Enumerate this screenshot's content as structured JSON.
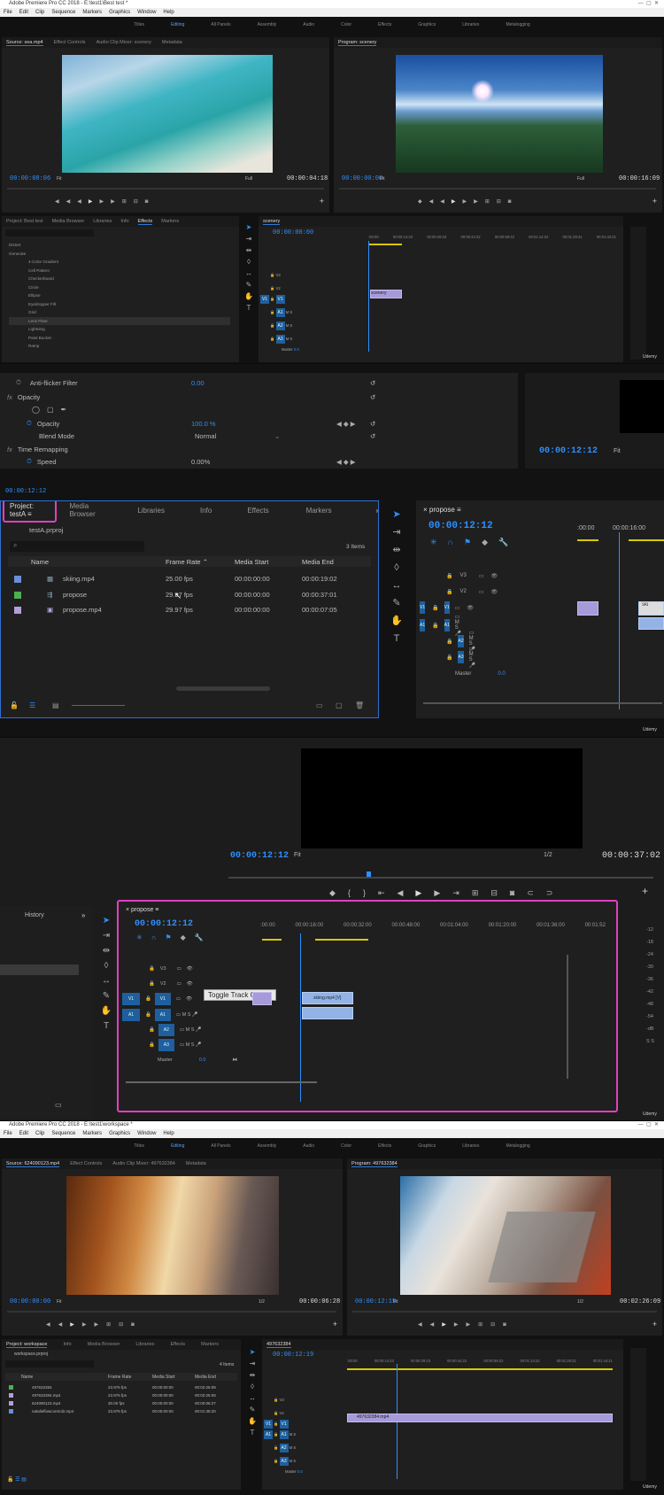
{
  "s1": {
    "title": "Adobe Premiere Pro CC 2018 - E:\\test1\\Best test *",
    "menu": [
      "File",
      "Edit",
      "Clip",
      "Sequence",
      "Markers",
      "Graphics",
      "Window",
      "Help"
    ],
    "workspaces": [
      "Titles",
      "Editing",
      "All Panels",
      "Assembly",
      "Audio",
      "Color",
      "Effects",
      "Graphics",
      "Libraries",
      "Metalogging"
    ],
    "source_tabs": [
      "Source: sea.mp4",
      "Effect Controls",
      "Audio Clip Mixer: scenery",
      "Metadata"
    ],
    "program_tab": "Program: scenery",
    "src_tc": "00:00:08:06",
    "src_fit": "Fit",
    "src_full": "Full",
    "src_dur": "00:00:04:18",
    "prg_tc": "00:00:00:00",
    "prg_fit": "Fit",
    "prg_full": "Full",
    "prg_dur": "00:00:16:09",
    "effects_tabs": [
      "Project: Best test",
      "Media Browser",
      "Libraries",
      "Info",
      "Effects",
      "Markers"
    ],
    "effects_list": [
      "Distort",
      "Generate",
      "4-Color Gradient",
      "Cell Pattern",
      "Checkerboard",
      "Circle",
      "Ellipse",
      "Eyedropper Fill",
      "Grid",
      "Lens Flare",
      "Lightning",
      "Paint Bucket",
      "Ramp"
    ],
    "seq_tab": "scenery",
    "seq_tc": "00:00:00:00",
    "ruler": [
      ":00:00",
      "00:00:14:23",
      "00:00:29:23",
      "00:00:44:22",
      "00:00:59:22",
      "00:01:14:22",
      "00:01:29:21",
      "00:01:44:21"
    ],
    "clip": "scenery",
    "tracks_v": [
      "V3",
      "V2",
      "V1"
    ],
    "tracks_a": [
      "A1",
      "A2",
      "A3"
    ],
    "master": "Master",
    "master_val": "0.0"
  },
  "s2": {
    "ec_rows": [
      "Anti-flicker Filter",
      "Opacity",
      "Opacity",
      "Blend Mode",
      "Time Remapping",
      "Speed"
    ],
    "anti_val": "0.00",
    "opacity_val": "100.0 %",
    "blend_val": "Normal",
    "speed_val": "0.00%",
    "ec_tc": "00:00:12:12",
    "mon_tc": "00:00:12:12",
    "mon_fit": "Fit",
    "proj_tabs": [
      "Project: testA",
      "Media Browser",
      "Libraries",
      "Info",
      "Effects",
      "Markers"
    ],
    "proj_file": "testA.prproj",
    "items_count": "3 Items",
    "cols": [
      "Name",
      "Frame Rate",
      "Media Start",
      "Media End"
    ],
    "rows": [
      {
        "name": "skiing.mp4",
        "fps": "25.00 fps",
        "start": "00:00:00:00",
        "end": "00:00:19:02",
        "color": "#6a8fd8"
      },
      {
        "name": "propose",
        "fps": "29.97 fps",
        "start": "00:00:00:00",
        "end": "00:00:37:01",
        "color": "#4caf50"
      },
      {
        "name": "propose.mp4",
        "fps": "29.97 fps",
        "start": "00:00:00:00",
        "end": "00:00:07:05",
        "color": "#b39ddb"
      }
    ],
    "seq_tab": "propose",
    "seq_tc": "00:00:12:12",
    "ruler": [
      ":00:00",
      "00:00:16:00"
    ],
    "tracks_v": [
      "V3",
      "V2",
      "V1"
    ],
    "tracks_a": [
      "A1",
      "A2",
      "A3"
    ],
    "master": "Master",
    "master_val": "0.0",
    "clip_label": "ski"
  },
  "s3": {
    "prg_tc": "00:00:12:12",
    "prg_fit": "Fit",
    "prg_res": "1/2",
    "prg_dur": "00:00:37:02",
    "history": "History",
    "seq_tab": "propose",
    "seq_tc": "00:00:12:12",
    "ruler": [
      ":00:00",
      "00:00:16:00",
      "00:00:32:00",
      "00:00:48:00",
      "00:01:04:00",
      "00:01:20:00",
      "00:01:36:00",
      "00:01:52"
    ],
    "tracks_v": [
      "V3",
      "V2",
      "V1"
    ],
    "tracks_a": [
      "A1",
      "A2",
      "A3"
    ],
    "tooltip": "Toggle Track Output",
    "clip": "skiing.mp4 [V]",
    "master": "Master",
    "master_val": "0.0",
    "meter": [
      "-12",
      "-18",
      "-24",
      "-30",
      "-36",
      "-42",
      "-48",
      "-54",
      "-dB"
    ],
    "meter_end": "S S"
  },
  "s4": {
    "title": "Adobe Premiere Pro CC 2018 - E:\\test1\\workspace *",
    "menu": [
      "File",
      "Edit",
      "Clip",
      "Sequence",
      "Markers",
      "Graphics",
      "Window",
      "Help"
    ],
    "workspaces": [
      "Titles",
      "Editing",
      "All Panels",
      "Assembly",
      "Audio",
      "Color",
      "Effects",
      "Graphics",
      "Libraries",
      "Metalogging"
    ],
    "source_tabs": [
      "Source: 624090123.mp4",
      "Effect Controls",
      "Audio Clip Mixer: 497632384",
      "Metadata"
    ],
    "program_tab": "Program: 497632384",
    "src_tc": "00:00:00:00",
    "src_fit": "Fit",
    "src_res": "1/2",
    "src_dur": "00:00:06:28",
    "prg_tc": "00:00:12:19",
    "prg_fit": "Fit",
    "prg_res": "1/2",
    "prg_dur": "00:02:26:09",
    "proj_tabs": [
      "Project: workspace",
      "Info",
      "Media Browser",
      "Libraries",
      "Effects",
      "Markers"
    ],
    "proj_file": "workspace.prproj",
    "items_count": "4 Items",
    "cols": [
      "Name",
      "Frame Rate",
      "Media Start",
      "Media End"
    ],
    "rows": [
      {
        "name": "497632384",
        "fps": "23.976 fps",
        "start": "00:00:00:00",
        "end": "00:02:26:08",
        "color": "#4caf50"
      },
      {
        "name": "497632384.mp4",
        "fps": "23.976 fps",
        "start": "00:00:00:00",
        "end": "00:02:26:08",
        "color": "#b39ddb"
      },
      {
        "name": "624090123.mp4",
        "fps": "30.00 fps",
        "start": "00:00:00:00",
        "end": "00:00:06:27",
        "color": "#b39ddb"
      },
      {
        "name": "natalieflowcontrol2.mp4",
        "fps": "23.976 fps",
        "start": "00:00:00:00",
        "end": "00:01:38:20",
        "color": "#6a8fd8"
      }
    ],
    "seq_tab": "497632384",
    "seq_tc": "00:00:12:19",
    "ruler": [
      ":00:00",
      "00:00:14:23",
      "00:00:29:23",
      "00:00:44:22",
      "00:00:59:22",
      "00:01:14:22",
      "00:01:29:21",
      "00:01:44:21"
    ],
    "clip": "497632384.mp4",
    "tracks_v": [
      "V3",
      "V2",
      "V1"
    ],
    "tracks_a": [
      "A1",
      "A2",
      "A3"
    ],
    "master": "Master",
    "master_val": "0.0"
  },
  "accent": "#2e90ff",
  "highlight": "#e040c0",
  "udemy": "Udemy"
}
